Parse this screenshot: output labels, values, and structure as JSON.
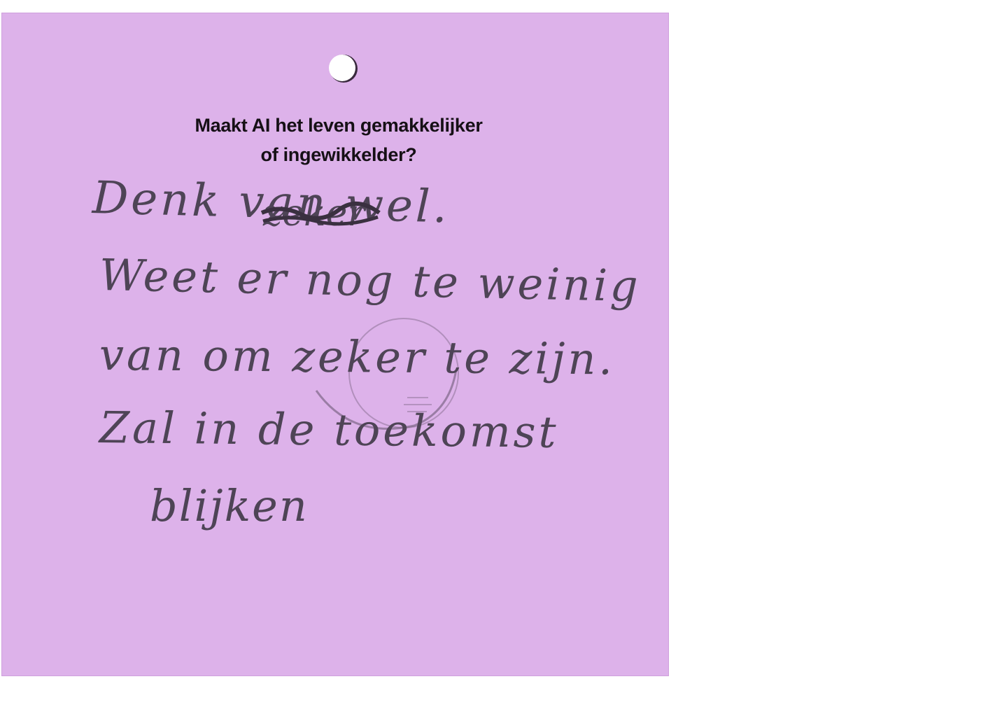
{
  "card": {
    "question_line1": "Maakt AI het leven gemakkelijker",
    "question_line2": "of ingewikkelder?",
    "answer_lines": [
      "Denk van wel.",
      "Weet er nog te weinig",
      "van om zeker te zijn.",
      "Zal in de toekomst",
      "blijken"
    ],
    "crossed_out_word": "zeker",
    "colors": {
      "card": "#ddb2ea",
      "print_text": "#161016",
      "handwriting": "#4e4456"
    },
    "icons": [
      "punch-hole-icon",
      "crescent-stamp-icon"
    ]
  }
}
